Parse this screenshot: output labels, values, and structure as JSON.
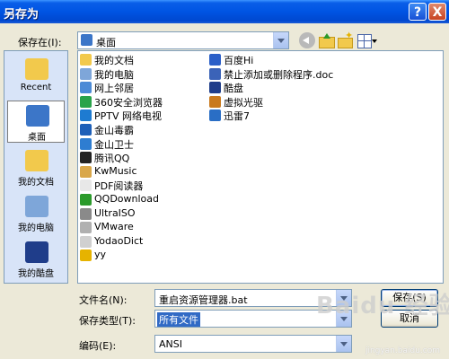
{
  "window": {
    "title": "另存为"
  },
  "titlebar": {
    "help_label": "?",
    "close_label": "X"
  },
  "save_in": {
    "label": "保存在(I):",
    "value": "桌面"
  },
  "places": [
    {
      "label": "Recent",
      "color": "#f2c94c"
    },
    {
      "label": "桌面",
      "color": "#3c76c8",
      "selected": true
    },
    {
      "label": "我的文档",
      "color": "#f2c94c"
    },
    {
      "label": "我的电脑",
      "color": "#7ea6d9"
    },
    {
      "label": "我的酷盘",
      "color": "#1f3d8a"
    }
  ],
  "files": {
    "left": [
      {
        "name": "我的文档",
        "color": "#f2c94c"
      },
      {
        "name": "我的电脑",
        "color": "#7ea6d9"
      },
      {
        "name": "网上邻居",
        "color": "#4d8bd6"
      },
      {
        "name": "360安全浏览器",
        "color": "#2aa34a"
      },
      {
        "name": "PPTV 网络电视",
        "color": "#1e7bd1"
      },
      {
        "name": "金山毒霸",
        "color": "#1d5fb8"
      },
      {
        "name": "金山卫士",
        "color": "#2e7dd1"
      },
      {
        "name": "腾讯QQ",
        "color": "#222222"
      },
      {
        "name": "KwMusic",
        "color": "#d9a74a"
      },
      {
        "name": "PDF阅读器",
        "color": "#e8e8e8"
      },
      {
        "name": "QQDownload",
        "color": "#2b9a2b"
      },
      {
        "name": "UltraISO",
        "color": "#8a8a8a"
      },
      {
        "name": "VMware",
        "color": "#b0b0b0"
      },
      {
        "name": "YodaoDict",
        "color": "#d0d0d0"
      },
      {
        "name": "yy",
        "color": "#e6b300"
      }
    ],
    "right": [
      {
        "name": "百度Hi",
        "color": "#2b5fc8"
      },
      {
        "name": "禁止添加或删除程序.doc",
        "color": "#3b63b8"
      },
      {
        "name": "酷盘",
        "color": "#1f3d8a"
      },
      {
        "name": "虚拟光驱",
        "color": "#c97a1e"
      },
      {
        "name": "迅雷7",
        "color": "#2a6ec5"
      }
    ]
  },
  "filename": {
    "label": "文件名(N):",
    "value": "重启资源管理器.bat"
  },
  "filetype": {
    "label": "保存类型(T):",
    "value": "所有文件"
  },
  "encoding": {
    "label": "编码(E):",
    "value": "ANSI"
  },
  "buttons": {
    "save": "保存(S)",
    "cancel": "取消"
  },
  "watermark": {
    "big": "Baidu 经验",
    "small": "jingyan.baidu.com"
  }
}
